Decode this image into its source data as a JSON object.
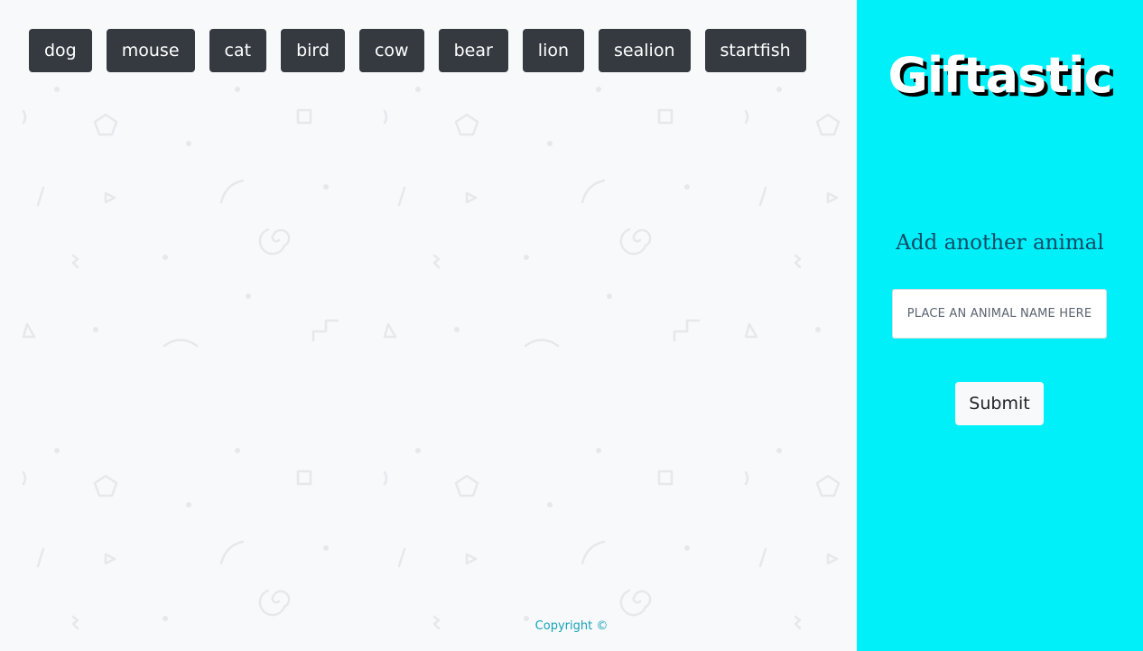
{
  "animal_buttons": [
    {
      "label": "dog"
    },
    {
      "label": "mouse"
    },
    {
      "label": "cat"
    },
    {
      "label": "bird"
    },
    {
      "label": "cow"
    },
    {
      "label": "bear"
    },
    {
      "label": "lion"
    },
    {
      "label": "sealion"
    },
    {
      "label": "startfish"
    }
  ],
  "sidebar": {
    "title": "Giftastic",
    "heading": "Add another animal",
    "input_placeholder": "PLACE AN ANIMAL NAME HERE",
    "input_value": "",
    "submit_label": "Submit"
  },
  "footer": {
    "copyright": "Copyright ©"
  },
  "colors": {
    "page_background": "#f8f9fb",
    "sidebar_background": "#00f0fa",
    "button_dark": "#343a40",
    "heading_text": "#114a66",
    "footer_text": "#17a2b8",
    "pattern_stroke": "#e6e8eb"
  }
}
